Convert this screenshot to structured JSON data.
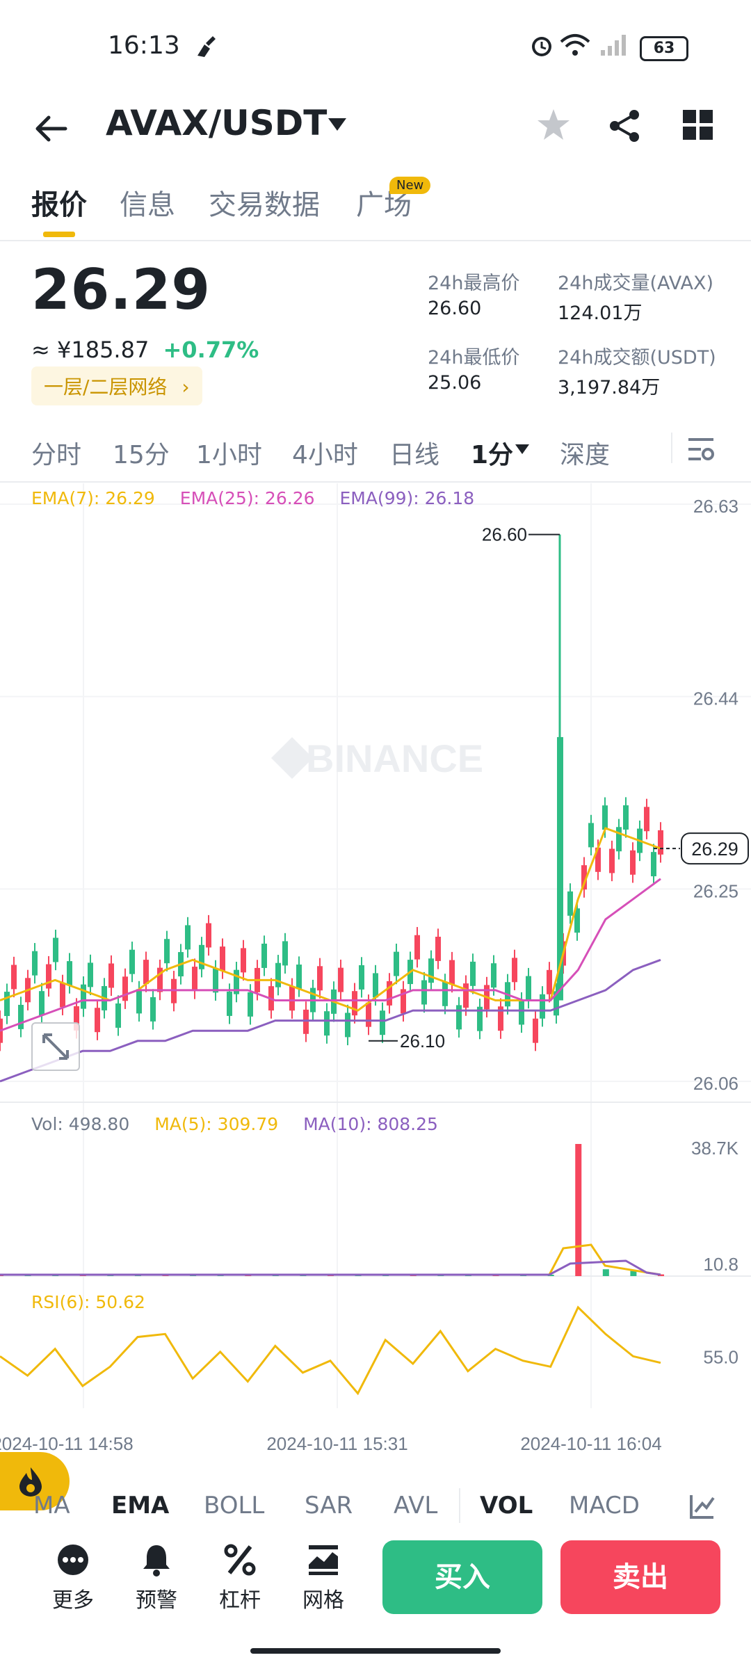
{
  "status_bar": {
    "time": "16:13",
    "battery": "63"
  },
  "header": {
    "pair": "AVAX/USDT"
  },
  "tabs": [
    {
      "label": "报价"
    },
    {
      "label": "信息"
    },
    {
      "label": "交易数据"
    },
    {
      "label": "广场"
    }
  ],
  "new_badge": "New",
  "price": {
    "last": "26.29",
    "cny": "≈ ¥185.87",
    "change": "+0.77%",
    "network_label": "一层/二层网络"
  },
  "stats": {
    "high_label": "24h最高价",
    "high_value": "26.60",
    "vol_base_label": "24h成交量(AVAX)",
    "vol_base_value": "124.01万",
    "low_label": "24h最低价",
    "low_value": "25.06",
    "vol_quote_label": "24h成交额(USDT)",
    "vol_quote_value": "3,197.84万"
  },
  "intervals": [
    "分时",
    "15分",
    "1小时",
    "4小时",
    "日线",
    "1分",
    "深度"
  ],
  "ema_legend": {
    "ema7": "EMA(7): 26.29",
    "ema25": "EMA(25): 26.26",
    "ema99": "EMA(99): 26.18"
  },
  "vol_legend": {
    "vol": "Vol: 498.80",
    "ma5": "MA(5): 309.79",
    "ma10": "MA(10): 808.25"
  },
  "rsi_legend": "RSI(6): 50.62",
  "watermark": "BINANCE",
  "colors": {
    "up": "#2ebd85",
    "down": "#f6465d",
    "ema7": "#f0b90b",
    "ema25": "#d64fb8",
    "ema99": "#8b5fbf",
    "accent": "#f0b90b"
  },
  "chart_data": [
    {
      "type": "candlestick",
      "title": "",
      "y_ticks": [
        "26.63",
        "26.44",
        "26.25",
        "26.06"
      ],
      "ylim": [
        26.06,
        26.63
      ],
      "current_price": "26.29",
      "annotations": {
        "high": "26.60",
        "low": "26.10"
      },
      "x_ticks": [
        "2024-10-11 14:58",
        "2024-10-11 15:31",
        "2024-10-11 16:04"
      ],
      "series": [
        {
          "name": "EMA(7)",
          "values": [
            26.14,
            26.15,
            26.16,
            26.15,
            26.14,
            26.15,
            26.17,
            26.18,
            26.17,
            26.16,
            26.16,
            26.15,
            26.14,
            26.13,
            26.15,
            26.17,
            26.16,
            26.15,
            26.14,
            26.14,
            26.14,
            26.24,
            26.31,
            26.3,
            26.29
          ]
        },
        {
          "name": "EMA(25)",
          "values": [
            26.11,
            26.12,
            26.13,
            26.14,
            26.14,
            26.15,
            26.15,
            26.15,
            26.15,
            26.15,
            26.14,
            26.14,
            26.14,
            26.14,
            26.14,
            26.15,
            26.15,
            26.15,
            26.15,
            26.14,
            26.14,
            26.17,
            26.22,
            26.24,
            26.26
          ]
        },
        {
          "name": "EMA(99)",
          "values": [
            26.06,
            26.07,
            26.08,
            26.09,
            26.09,
            26.1,
            26.1,
            26.11,
            26.11,
            26.11,
            26.12,
            26.12,
            26.12,
            26.12,
            26.12,
            26.13,
            26.13,
            26.13,
            26.13,
            26.13,
            26.13,
            26.14,
            26.15,
            26.17,
            26.18
          ]
        }
      ]
    },
    {
      "type": "bar",
      "title": "",
      "y_ticks": [
        "38.7K",
        "10.8"
      ],
      "series": [
        {
          "name": "Vol",
          "values": [
            300,
            150,
            200,
            100,
            250,
            180,
            400,
            220,
            150,
            180,
            120,
            300,
            200,
            180,
            260,
            500,
            240,
            320,
            180,
            200,
            400,
            38700,
            2000,
            1500,
            498.8
          ]
        }
      ]
    },
    {
      "type": "line",
      "title": "",
      "y_ticks": [
        "55.0"
      ],
      "series": [
        {
          "name": "RSI(6)",
          "values": [
            55,
            42,
            60,
            35,
            48,
            68,
            70,
            40,
            58,
            38,
            62,
            44,
            52,
            30,
            66,
            50,
            72,
            45,
            60,
            52,
            48,
            88,
            70,
            55,
            50.62
          ]
        }
      ]
    }
  ],
  "indicators": [
    "MA",
    "EMA",
    "BOLL",
    "SAR",
    "AVL",
    "VOL",
    "MACD"
  ],
  "actions": [
    {
      "label": "更多"
    },
    {
      "label": "预警"
    },
    {
      "label": "杠杆"
    },
    {
      "label": "网格"
    }
  ],
  "buy_label": "买入",
  "sell_label": "卖出"
}
